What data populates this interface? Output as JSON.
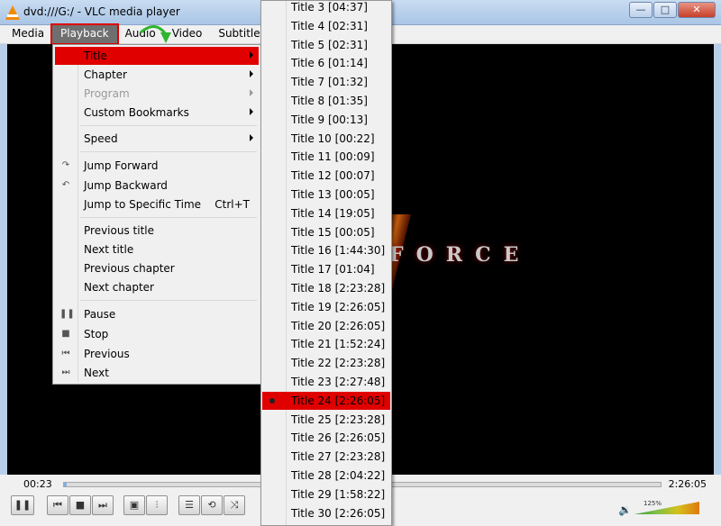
{
  "window": {
    "title": "dvd:///G:/ - VLC media player",
    "min": "—",
    "max": "□",
    "close": "✕"
  },
  "menubar": [
    "Media",
    "Playback",
    "Audio",
    "Video",
    "Subtitle",
    "To"
  ],
  "playback_menu": {
    "title": "Title",
    "chapter": "Chapter",
    "program": "Program",
    "bookmarks": "Custom Bookmarks",
    "speed": "Speed",
    "jump_forward": "Jump Forward",
    "jump_backward": "Jump Backward",
    "jump_time": "Jump to Specific Time",
    "jump_time_shortcut": "Ctrl+T",
    "prev_title": "Previous title",
    "next_title": "Next title",
    "prev_chapter": "Previous chapter",
    "next_chapter": "Next chapter",
    "pause": "Pause",
    "stop": "Stop",
    "previous": "Previous",
    "next": "Next"
  },
  "titles": [
    "Title 3 [04:37]",
    "Title 4 [02:31]",
    "Title 5 [02:31]",
    "Title 6 [01:14]",
    "Title 7 [01:32]",
    "Title 8 [01:35]",
    "Title 9 [00:13]",
    "Title 10 [00:22]",
    "Title 11 [00:09]",
    "Title 12 [00:07]",
    "Title 13 [00:05]",
    "Title 14 [19:05]",
    "Title 15 [00:05]",
    "Title 16 [1:44:30]",
    "Title 17 [01:04]",
    "Title 18 [2:23:28]",
    "Title 19 [2:26:05]",
    "Title 20 [2:26:05]",
    "Title 21 [1:52:24]",
    "Title 22 [2:23:28]",
    "Title 23 [2:27:48]",
    "Title 24 [2:26:05]",
    "Title 25 [2:23:28]",
    "Title 26 [2:26:05]",
    "Title 27 [2:23:28]",
    "Title 28 [2:04:22]",
    "Title 29 [1:58:22]",
    "Title 30 [2:26:05]"
  ],
  "selected_title_index": 21,
  "video": {
    "logo_text": "FORCE"
  },
  "controls": {
    "time_current": "00:23",
    "time_total": "2:26:05",
    "progress": 0.003,
    "volume_label": "125%",
    "volume": 1.25
  },
  "colors": {
    "highlight": "#e00000",
    "accent": "#2a7a2a"
  }
}
